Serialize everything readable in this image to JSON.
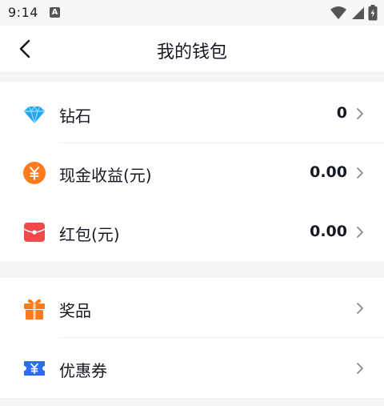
{
  "status_bar": {
    "time": "9:14",
    "notification_icon": "A"
  },
  "header": {
    "title": "我的钱包"
  },
  "sections": [
    {
      "items": [
        {
          "label": "钻石",
          "value": "0",
          "icon": "diamond-icon"
        },
        {
          "label": "现金收益(元)",
          "value": "0.00",
          "icon": "yuan-coin-icon"
        },
        {
          "label": "红包(元)",
          "value": "0.00",
          "icon": "red-envelope-icon"
        }
      ]
    },
    {
      "items": [
        {
          "label": "奖品",
          "value": "",
          "icon": "gift-icon"
        },
        {
          "label": "优惠券",
          "value": "",
          "icon": "coupon-icon"
        }
      ]
    }
  ],
  "colors": {
    "diamond": "#1fa6f5",
    "coin": "#ff7a1a",
    "envelope": "#f04a4a",
    "gift": "#ff7a1a",
    "coupon": "#2d6cf6",
    "chevron": "#8a8b91"
  }
}
